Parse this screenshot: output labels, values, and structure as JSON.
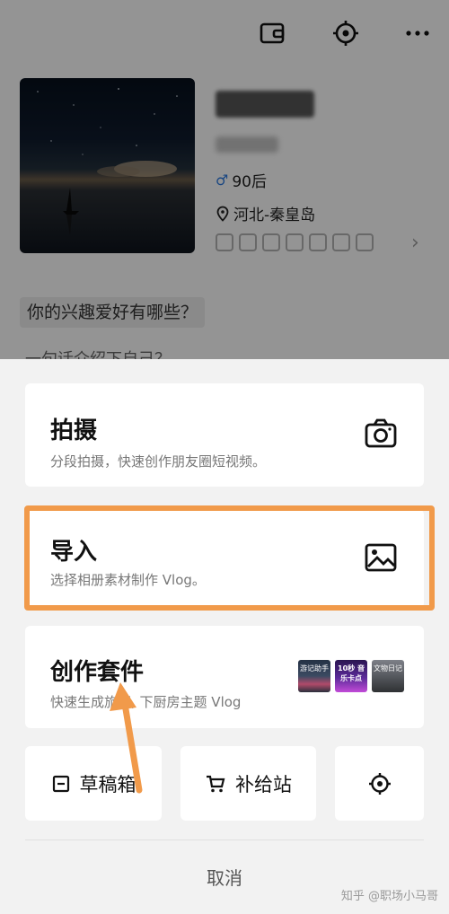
{
  "profile": {
    "age_label": "90后",
    "location": "河北-秦皇岛",
    "question_chip": "你的兴趣爱好有哪些？",
    "question_next": "一句话介绍下自己？"
  },
  "sheet": {
    "shoot": {
      "title": "拍摄",
      "desc": "分段拍摄，快速创作朋友圈短视频。"
    },
    "import": {
      "title": "导入",
      "desc": "选择相册素材制作 Vlog。"
    },
    "kit": {
      "title": "创作套件",
      "desc": "快速生成旅行, 下厨房主题 Vlog",
      "thumbs": [
        "游记助手",
        "10秒 音乐卡点",
        "文物日记"
      ]
    },
    "drafts_label": "草稿箱",
    "supply_label": "补给站",
    "cancel_label": "取消"
  },
  "watermark": "知乎 @职场小马哥",
  "colors": {
    "highlight": "#f19a4a",
    "arrow": "#f19a4a"
  }
}
